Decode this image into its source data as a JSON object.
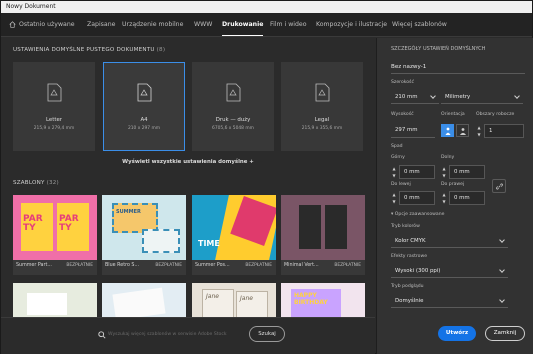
{
  "window": {
    "title": "Nowy Dokument"
  },
  "tabs": [
    {
      "label": "Ostatnio używane"
    },
    {
      "label": "Zapisane"
    },
    {
      "label": "Urządzenie mobilne"
    },
    {
      "label": "WWW"
    },
    {
      "label": "Drukowanie",
      "active": true
    },
    {
      "label": "Film i wideo"
    },
    {
      "label": "Kompozycje i ilustracje"
    },
    {
      "label": "Więcej szablonów"
    }
  ],
  "presets_section": {
    "title": "USTAWIENIA DOMYŚLNE PUSTEGO DOKUMENTU",
    "count": "(8)"
  },
  "presets": [
    {
      "name": "Letter",
      "size": "215,9 x 279,4 mm"
    },
    {
      "name": "A4",
      "size": "210 x 297 mm",
      "selected": true
    },
    {
      "name": "Druk — duży",
      "size": "6705,6 x 5048 mm"
    },
    {
      "name": "Legal",
      "size": "215,9 x 355,6 mm"
    }
  ],
  "show_all_label": "Wyświetl wszystkie ustawienia domyślne +",
  "templates_section": {
    "title": "SZABLONY",
    "count": "(32)"
  },
  "templates": [
    {
      "name": "Summer Part...",
      "badge": "BEZPŁATNIE"
    },
    {
      "name": "Blue Retro S...",
      "badge": "BEZPŁATNIE"
    },
    {
      "name": "Summer Pos...",
      "badge": "BEZPŁATNIE"
    },
    {
      "name": "Minimal Vert...",
      "badge": "BEZPŁATNIE"
    }
  ],
  "search": {
    "placeholder": "Wyszukaj więcej szablonów w serwisie Adobe Stock",
    "button": "Szukaj"
  },
  "details": {
    "title": "SZCZEGÓŁY USTAWIEŃ DOMYŚLNYCH",
    "doc_name": "Bez nazwy-1",
    "width_label": "Szerokość",
    "width_value": "210 mm",
    "units": "Milimetry",
    "height_label": "Wysokość",
    "height_value": "297 mm",
    "orientation_label": "Orientacja",
    "artboards_label": "Obszary robocze",
    "artboards_value": "1",
    "bleed_label": "Spad",
    "top_label": "Górny",
    "top_value": "0 mm",
    "bottom_label": "Dolny",
    "bottom_value": "0 mm",
    "left_label": "Do lewej",
    "left_value": "0 mm",
    "right_label": "Do prawej",
    "right_value": "0 mm",
    "advanced_label": "Opcje zaawansowane",
    "color_mode_label": "Tryb kolorów",
    "color_mode_value": "Kolor CMYK",
    "raster_label": "Efekty rastrowe",
    "raster_value": "Wysoki (300 ppi)",
    "preview_label": "Tryb podglądu",
    "preview_value": "Domyślnie",
    "create_button": "Utwórz",
    "close_button": "Zamknij"
  },
  "colors": {
    "accent": "#1473e6",
    "selection": "#3b8ee8"
  }
}
